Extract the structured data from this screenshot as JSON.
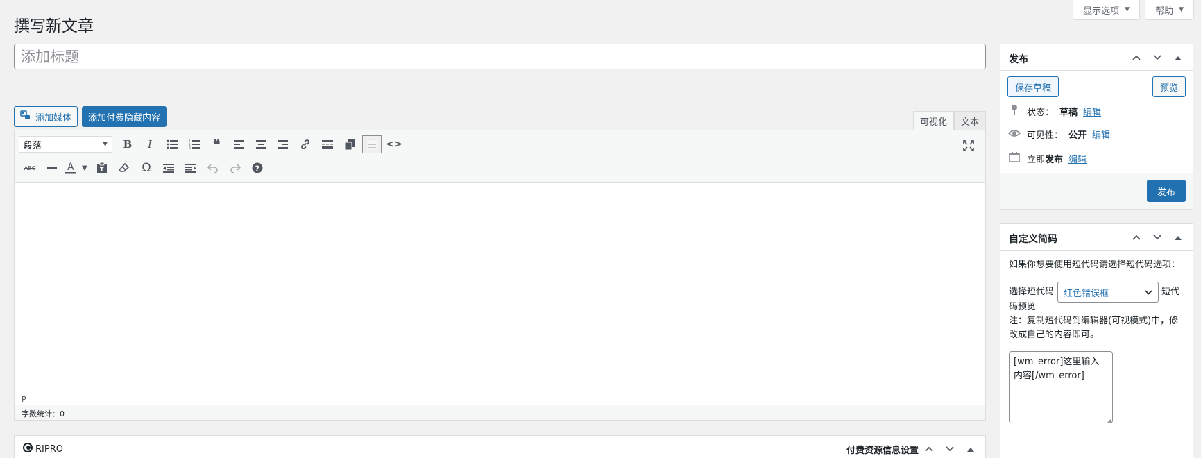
{
  "screen_meta": {
    "options_label": "显示选项",
    "help_label": "帮助"
  },
  "page_title": "撰写新文章",
  "title_input": {
    "placeholder": "添加标题",
    "value": ""
  },
  "media": {
    "add_media_label": "添加媒体",
    "add_paid_label": "添加付费隐藏内容"
  },
  "editor_tabs": {
    "visual": "可视化",
    "text": "文本"
  },
  "toolbar": {
    "format_selected": "段落",
    "row1_icons": [
      "bold-icon",
      "italic-icon",
      "bullet-list-icon",
      "numbered-list-icon",
      "blockquote-icon",
      "align-left-icon",
      "align-center-icon",
      "align-right-icon",
      "link-icon",
      "read-more-icon",
      "copy-icon",
      "toolbar-toggle-icon",
      "code-icon"
    ],
    "row2_icons": [
      "strikethrough-icon",
      "horizontal-line-icon",
      "text-color-icon",
      "paste-text-icon",
      "clear-format-icon",
      "special-char-icon",
      "outdent-icon",
      "indent-icon",
      "undo-icon",
      "redo-icon",
      "help-icon"
    ]
  },
  "editor": {
    "path": "P",
    "word_count": "字数统计：0"
  },
  "ripro": {
    "brand": "RIPRO",
    "title": "付费资源信息设置"
  },
  "publish": {
    "title": "发布",
    "save_draft_label": "保存草稿",
    "preview_label": "预览",
    "status_label": "状态：",
    "status_value": "草稿",
    "visibility_label": "可见性：",
    "visibility_value": "公开",
    "schedule_prefix": "立即",
    "schedule_label": "发布",
    "edit_link": "编辑",
    "publish_label": "发布"
  },
  "shortcode": {
    "title": "自定义简码",
    "intro": "如果你想要使用短代码请选择短代码选项：",
    "select_label": "选择短代码",
    "selected": "红色错误框",
    "preview_label_a": "短代",
    "preview_label_b": "码预览",
    "note": "注：复制短代码到编辑器(可视模式)中，修改成自己的内容即可。",
    "textarea_value": "[wm_error]这里输入内容[/wm_error]"
  },
  "colors": {
    "accent": "#2271b1",
    "background": "#f1f1f1",
    "border": "#dcdcde"
  }
}
